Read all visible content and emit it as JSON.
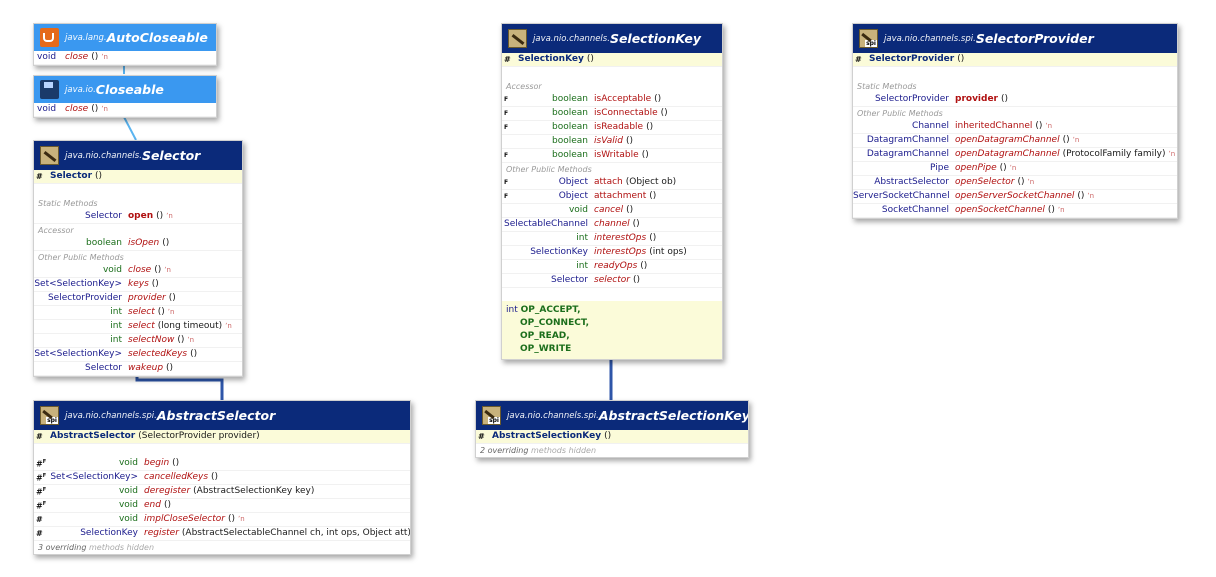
{
  "colors": {
    "header_dark": "#0b2a7a",
    "header_light": "#3a98f0",
    "constructor_bg": "#fbfbd9",
    "method_name": "#b01010",
    "type_name": "#1a1a8c",
    "connector_interface": "#5ab4f0",
    "connector_class": "#2e55a8"
  },
  "autocloseable": {
    "icon": "coffee-cup-icon",
    "package": "java.lang.",
    "name": "AutoCloseable",
    "methods": [
      {
        "ret": "void",
        "name": "close",
        "params": "()"
      }
    ]
  },
  "closeable": {
    "icon": "disk-icon",
    "package": "java.io.",
    "name": "Closeable",
    "methods": [
      {
        "ret": "void",
        "name": "close",
        "params": "()"
      }
    ]
  },
  "selector": {
    "icon": "interface-icon",
    "package": "java.nio.channels.",
    "name": "Selector",
    "ctor": {
      "mod": "#",
      "name": "Selector",
      "params": "()"
    },
    "sections": [
      {
        "label": "Static Methods"
      },
      {
        "label": "Accessor"
      },
      {
        "label": "Other Public Methods"
      }
    ],
    "methods": [
      {
        "ret": "Selector",
        "name": "open",
        "params": "()"
      },
      {
        "ret": "boolean",
        "name": "isOpen",
        "params": "()"
      },
      {
        "ret": "void",
        "name": "close",
        "params": "()"
      },
      {
        "ret": "Set<SelectionKey>",
        "name": "keys",
        "params": "()"
      },
      {
        "ret": "SelectorProvider",
        "name": "provider",
        "params": "()"
      },
      {
        "ret": "int",
        "name": "select",
        "params": "()"
      },
      {
        "ret": "int",
        "name": "select",
        "params": "(long timeout)"
      },
      {
        "ret": "int",
        "name": "selectNow",
        "params": "()"
      },
      {
        "ret": "Set<SelectionKey>",
        "name": "selectedKeys",
        "params": "()"
      },
      {
        "ret": "Selector",
        "name": "wakeup",
        "params": "()"
      }
    ]
  },
  "abstractselector": {
    "icon": "spi-icon",
    "package": "java.nio.channels.spi.",
    "name": "AbstractSelector",
    "ctor": {
      "mod": "#",
      "name": "AbstractSelector",
      "params": "(SelectorProvider provider)"
    },
    "methods": [
      {
        "mod": "#",
        "ret": "void",
        "name": "begin",
        "params": "()"
      },
      {
        "mod": "#",
        "ret": "Set<SelectionKey>",
        "name": "cancelledKeys",
        "params": "()"
      },
      {
        "mod": "#",
        "ret": "void",
        "name": "deregister",
        "params": "(AbstractSelectionKey key)"
      },
      {
        "mod": "#",
        "ret": "void",
        "name": "end",
        "params": "()"
      },
      {
        "mod": "#",
        "ret": "void",
        "name": "implCloseSelector",
        "params": "()"
      },
      {
        "mod": "#",
        "ret": "SelectionKey",
        "name": "register",
        "params": "(AbstractSelectableChannel ch, int ops, Object att)"
      }
    ],
    "hidden_count": "3 overriding",
    "hidden_text": "methods hidden"
  },
  "selectionkey": {
    "icon": "interface-icon",
    "package": "java.nio.channels.",
    "name": "SelectionKey",
    "ctor": {
      "mod": "#",
      "name": "SelectionKey",
      "params": "()"
    },
    "sections": [
      {
        "label": "Accessor"
      },
      {
        "label": "Other Public Methods"
      }
    ],
    "methods": [
      {
        "mod": "F",
        "ret": "boolean",
        "name": "isAcceptable",
        "params": "()"
      },
      {
        "mod": "F",
        "ret": "boolean",
        "name": "isConnectable",
        "params": "()"
      },
      {
        "mod": "F",
        "ret": "boolean",
        "name": "isReadable",
        "params": "()"
      },
      {
        "mod": "",
        "ret": "boolean",
        "name": "isValid",
        "params": "()"
      },
      {
        "mod": "F",
        "ret": "boolean",
        "name": "isWritable",
        "params": "()"
      },
      {
        "mod": "F",
        "ret": "Object",
        "name": "attach",
        "params": "(Object ob)"
      },
      {
        "mod": "F",
        "ret": "Object",
        "name": "attachment",
        "params": "()"
      },
      {
        "mod": "",
        "ret": "void",
        "name": "cancel",
        "params": "()"
      },
      {
        "mod": "",
        "ret": "SelectableChannel",
        "name": "channel",
        "params": "()"
      },
      {
        "mod": "",
        "ret": "int",
        "name": "interestOps",
        "params": "()"
      },
      {
        "mod": "",
        "ret": "SelectionKey",
        "name": "interestOps",
        "params": "(int ops)"
      },
      {
        "mod": "",
        "ret": "int",
        "name": "readyOps",
        "params": "()"
      },
      {
        "mod": "",
        "ret": "Selector",
        "name": "selector",
        "params": "()"
      }
    ],
    "const_type": "int",
    "constants": [
      "OP_ACCEPT,",
      "OP_CONNECT,",
      "OP_READ,",
      "OP_WRITE"
    ]
  },
  "abstractselectionkey": {
    "icon": "spi-icon",
    "package": "java.nio.channels.spi.",
    "name": "AbstractSelectionKey",
    "ctor": {
      "mod": "#",
      "name": "AbstractSelectionKey",
      "params": "()"
    },
    "hidden_count": "2 overriding",
    "hidden_text": "methods hidden"
  },
  "selectorprovider": {
    "icon": "spi-icon",
    "package": "java.nio.channels.spi.",
    "name": "SelectorProvider",
    "ctor": {
      "mod": "#",
      "name": "SelectorProvider",
      "params": "()"
    },
    "sections": [
      {
        "label": "Static Methods"
      },
      {
        "label": "Other Public Methods"
      }
    ],
    "methods": [
      {
        "ret": "SelectorProvider",
        "name": "provider",
        "params": "()"
      },
      {
        "ret": "Channel",
        "name": "inheritedChannel",
        "params": "()"
      },
      {
        "ret": "DatagramChannel",
        "name": "openDatagramChannel",
        "params": "()"
      },
      {
        "ret": "DatagramChannel",
        "name": "openDatagramChannel",
        "params": "(ProtocolFamily family)"
      },
      {
        "ret": "Pipe",
        "name": "openPipe",
        "params": "()"
      },
      {
        "ret": "AbstractSelector",
        "name": "openSelector",
        "params": "()"
      },
      {
        "ret": "ServerSocketChannel",
        "name": "openServerSocketChannel",
        "params": "()"
      },
      {
        "ret": "SocketChannel",
        "name": "openSocketChannel",
        "params": "()"
      }
    ]
  }
}
